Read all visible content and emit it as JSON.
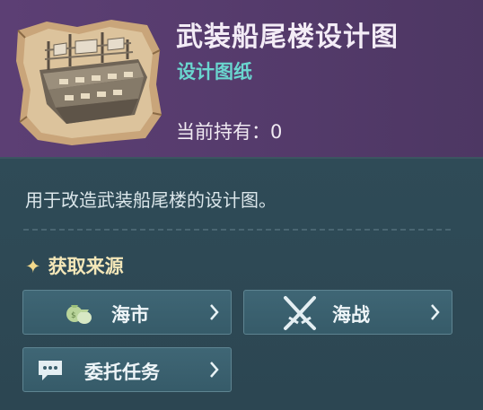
{
  "item": {
    "title": "武装船尾楼设计图",
    "subtitle": "设计图纸",
    "holding": "当前持有：0",
    "description": "用于改造武装船尾楼的设计图。"
  },
  "sources": {
    "heading": "获取来源",
    "buttons": [
      {
        "label": "海市",
        "icon": "coin-bags-icon"
      },
      {
        "label": "海战",
        "icon": "crossed-swords-icon"
      },
      {
        "label": "委托任务",
        "icon": "chat-bubble-icon"
      }
    ]
  },
  "colors": {
    "header_bg": "#5c3f74",
    "body_bg": "#2f4b57",
    "subtitle": "#6ad6cf",
    "button_bg": "#3f6675",
    "heading": "#f4e7b8"
  }
}
